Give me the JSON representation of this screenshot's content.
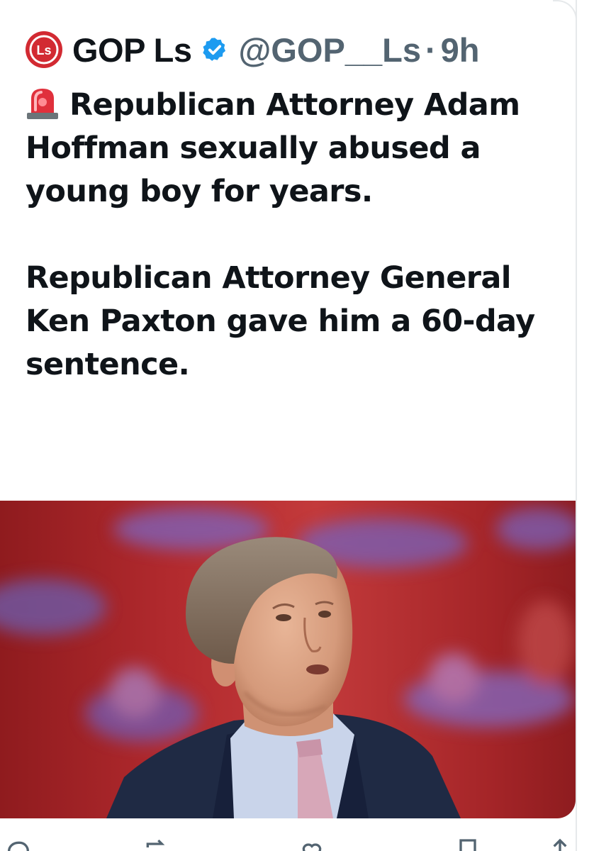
{
  "tweet": {
    "author": {
      "display_name": "GOP Ls",
      "handle": "@GOP__Ls",
      "verified": true,
      "avatar_letters": "Ls",
      "avatar_color": "#d22a32"
    },
    "separator": "·",
    "timestamp": "9h",
    "paragraphs": [
      "Republican Attorney Adam Hoffman sexually abused a young boy for years.",
      "Republican Attorney General Ken Paxton gave him a 60-day sentence."
    ],
    "leading_emoji": "police-light-icon",
    "media": {
      "icon": "photo",
      "background_color": "#b22a2e"
    },
    "actions": {
      "reply_count": "",
      "repost_count": "",
      "like_count": ""
    }
  },
  "colors": {
    "verified_badge": "#1d9bf0",
    "secondary_text": "#536471",
    "primary_text": "#0f1419"
  }
}
